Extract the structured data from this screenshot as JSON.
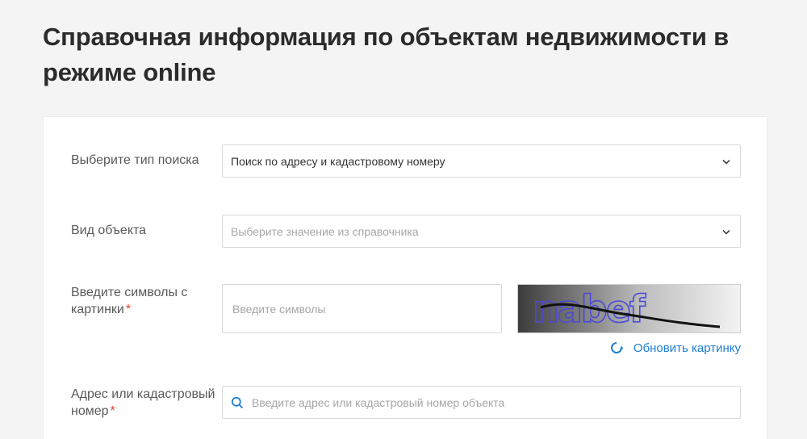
{
  "page": {
    "title": "Справочная информация по объектам недвижимости в режиме online"
  },
  "form": {
    "search_type": {
      "label": "Выберите тип поиска",
      "value": "Поиск по адресу и кадастровому номеру"
    },
    "object_type": {
      "label": "Вид объекта",
      "placeholder": "Выберите значение из справочника"
    },
    "captcha": {
      "label": "Введите символы с картинки",
      "required_mark": "*",
      "placeholder": "Введите символы",
      "image_text": "nabef",
      "refresh_label": "Обновить картинку"
    },
    "address": {
      "label": "Адрес или кадастровый номер",
      "required_mark": "*",
      "placeholder": "Введите адрес или кадастровый номер объекта"
    }
  },
  "icons": {
    "dropdown": "chevron-down-icon",
    "refresh": "refresh-icon",
    "search": "search-icon"
  },
  "colors": {
    "accent": "#1e7fd6",
    "required": "#e4432d",
    "background": "#f4f4f4"
  }
}
